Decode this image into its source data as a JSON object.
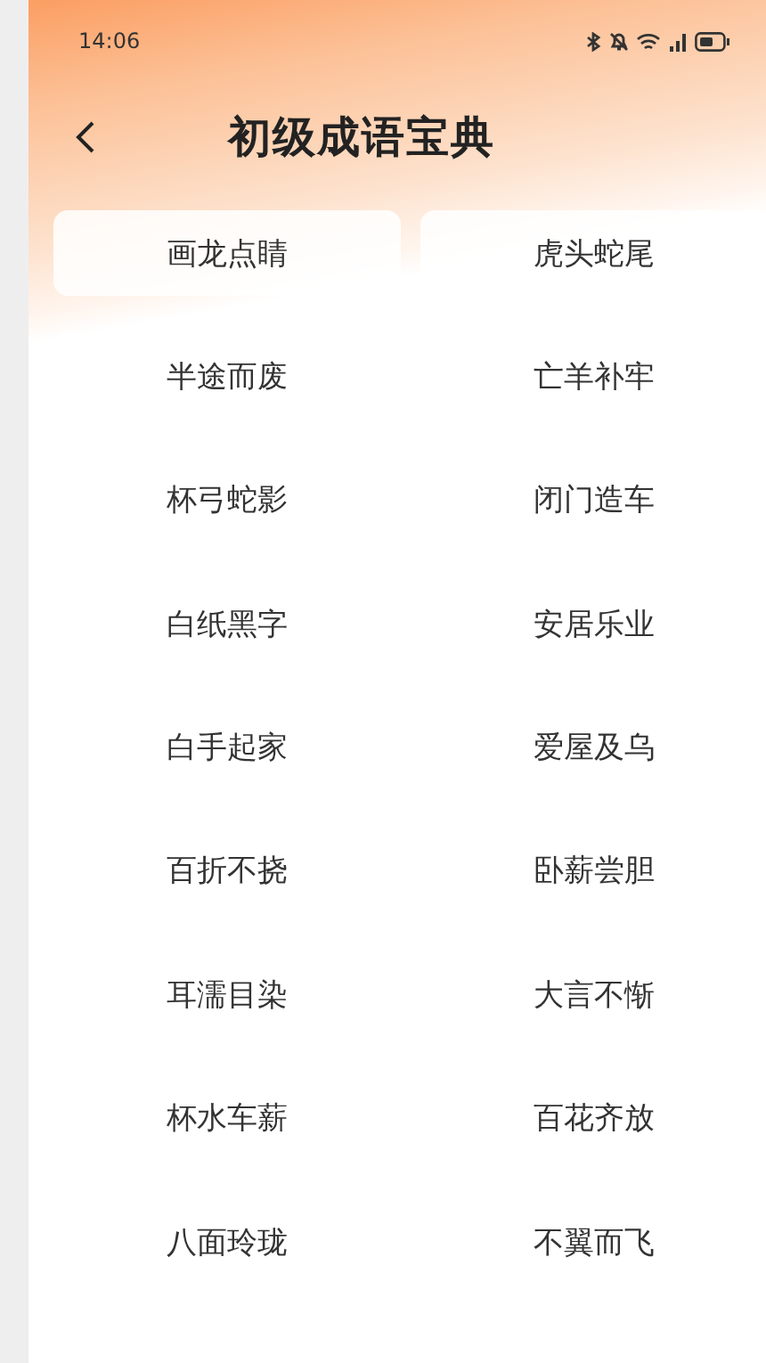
{
  "status_bar": {
    "time": "14:06"
  },
  "header": {
    "title": "初级成语宝典"
  },
  "idioms": [
    {
      "left": "画龙点睛",
      "right": "虎头蛇尾"
    },
    {
      "left": "半途而废",
      "right": "亡羊补牢"
    },
    {
      "left": "杯弓蛇影",
      "right": "闭门造车"
    },
    {
      "left": "白纸黑字",
      "right": "安居乐业"
    },
    {
      "left": "白手起家",
      "right": "爱屋及乌"
    },
    {
      "left": "百折不挠",
      "right": "卧薪尝胆"
    },
    {
      "left": "耳濡目染",
      "right": "大言不惭"
    },
    {
      "left": "杯水车薪",
      "right": "百花齐放"
    },
    {
      "left": "八面玲珑",
      "right": "不翼而飞"
    }
  ]
}
